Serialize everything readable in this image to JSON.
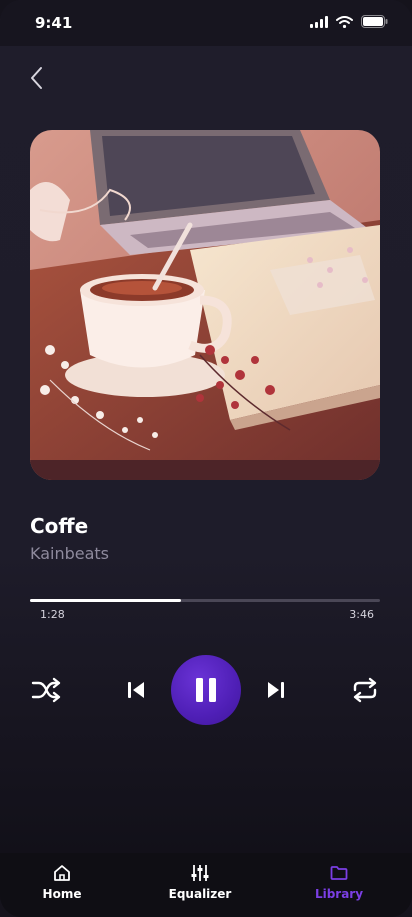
{
  "status_bar": {
    "time": "9:41"
  },
  "track": {
    "title": "Coffe",
    "artist": "Kainbeats",
    "elapsed": "1:28",
    "duration": "3:46",
    "progress": 0.43
  },
  "controls": {
    "shuffle_icon": "shuffle-icon",
    "prev_icon": "skip-previous-icon",
    "play_icon": "pause-icon",
    "next_icon": "skip-next-icon",
    "repeat_icon": "repeat-icon",
    "accent": "#5a26c9"
  },
  "bottom_nav": {
    "items": [
      {
        "label": "Home",
        "icon": "home-icon",
        "active": false
      },
      {
        "label": "Equalizer",
        "icon": "equalizer-icon",
        "active": false
      },
      {
        "label": "Library",
        "icon": "folder-icon",
        "active": true
      }
    ],
    "active_color": "#7b3fe4"
  }
}
